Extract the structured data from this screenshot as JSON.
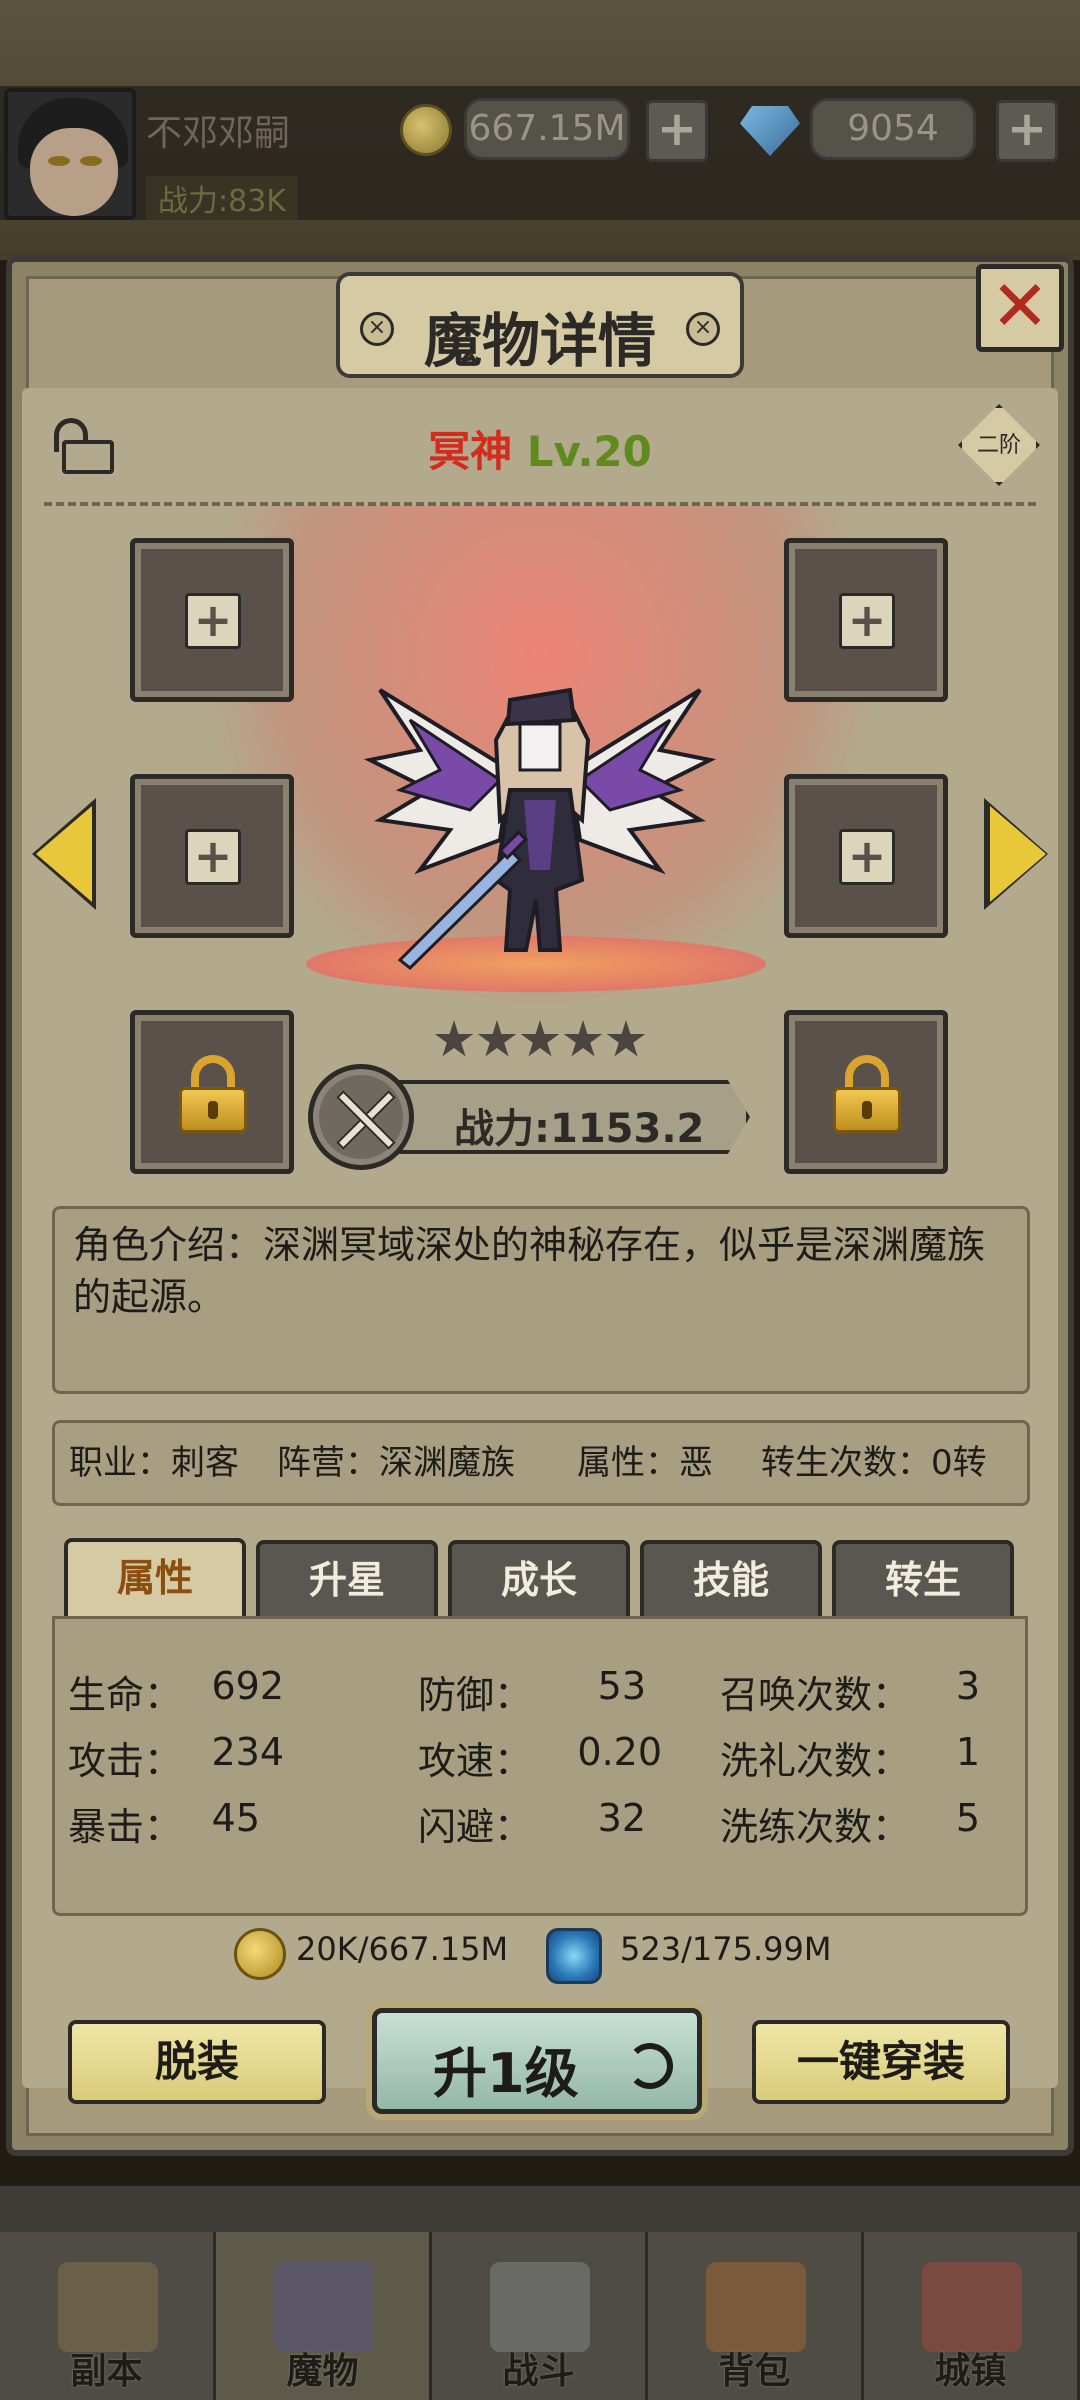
{
  "header": {
    "player_name": "不邓邓嗣",
    "power_label": "战力:83K",
    "gold": "667.15M",
    "gems": "9054",
    "plus_symbol": "+"
  },
  "modal": {
    "title": "魔物详情",
    "close_symbol": "✕",
    "monster": {
      "name": "冥神",
      "level": "Lv.20",
      "rank": "二阶"
    },
    "stars": 5,
    "power": "战力:1153.2",
    "intro": "角色介绍：深渊冥域深处的神秘存在，似乎是深渊魔族的起源。",
    "info": {
      "job": "职业：刺客",
      "camp": "阵营：深渊魔族",
      "attr": "属性：恶",
      "rebirth": "转生次数：0转"
    },
    "tabs": [
      "属性",
      "升星",
      "成长",
      "技能",
      "转生"
    ],
    "stats": [
      {
        "label": "生命：",
        "value": "692"
      },
      {
        "label": "攻击：",
        "value": "234"
      },
      {
        "label": "暴击：",
        "value": "45"
      },
      {
        "label": "防御：",
        "value": "53"
      },
      {
        "label": "攻速：",
        "value": "0.20"
      },
      {
        "label": "闪避：",
        "value": "32"
      },
      {
        "label": "召唤次数：",
        "value": "3"
      },
      {
        "label": "洗礼次数：",
        "value": "1"
      },
      {
        "label": "洗练次数：",
        "value": "5"
      }
    ],
    "costs": {
      "gold": "20K/667.15M",
      "orb": "523/175.99M"
    },
    "buttons": {
      "unequip": "脱装",
      "upgrade": "升1级",
      "equip_all": "一键穿装"
    }
  },
  "nav": [
    "副本",
    "魔物",
    "战斗",
    "背包",
    "城镇"
  ]
}
